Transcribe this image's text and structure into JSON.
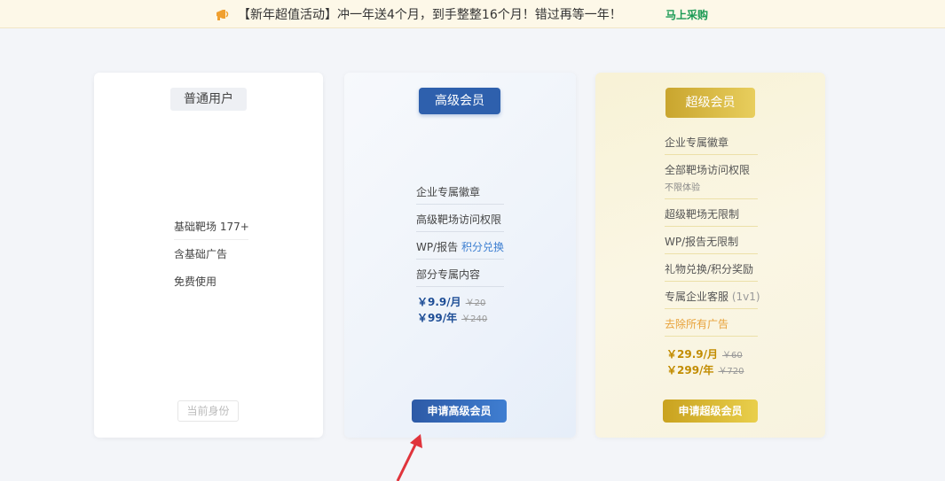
{
  "banner": {
    "icon": "megaphone-icon",
    "text": "【新年超值活动】冲一年送4个月，到手整整16个月！错过再等一年！",
    "link": "马上采购"
  },
  "plans": {
    "basic": {
      "title": "普通用户",
      "features": [
        "基础靶场 177+",
        "含基础广告",
        "免费使用"
      ],
      "button": "当前身份"
    },
    "pro": {
      "title": "高级会员",
      "features": [
        "企业专属徽章",
        "高级靶场访问权限",
        "部分专属内容"
      ],
      "wp_label": "WP/报告 ",
      "wp_link": "积分兑换",
      "price_month": "￥9.9/月",
      "price_month_old": "￥20",
      "price_year": "￥99/年",
      "price_year_old": "￥240",
      "button": "申请高级会员"
    },
    "super": {
      "title": "超级会员",
      "features": [
        "企业专属徽章",
        "全部靶场访问权限",
        "不限体验",
        "超级靶场无限制",
        "WP/报告无限制",
        "礼物兑换/积分奖励",
        "专属企业客服",
        "(1v1)",
        "去除所有广告"
      ],
      "price_month": "￥29.9/月",
      "price_month_old": "￥60",
      "price_year": "￥299/年",
      "price_year_old": "￥720",
      "button": "申请超级会员"
    }
  },
  "colors": {
    "pro_accent": "#2e60ad",
    "super_accent": "#c9a52e",
    "link_green": "#1a9a54",
    "arrow_red": "#e0343c"
  },
  "annotation": "red-arrow-icon"
}
